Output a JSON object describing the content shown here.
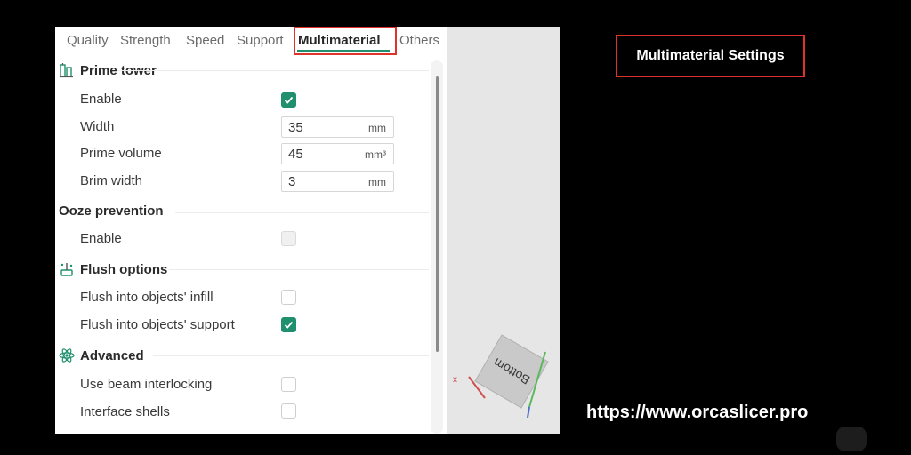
{
  "tabs": [
    {
      "label": "Quality"
    },
    {
      "label": "Strength"
    },
    {
      "label": "Speed"
    },
    {
      "label": "Support"
    },
    {
      "label": "Multimaterial",
      "active": true
    },
    {
      "label": "Others"
    }
  ],
  "sections": {
    "prime_tower": {
      "title": "Prime tower",
      "icon": "prime-tower-icon",
      "enable": {
        "label": "Enable",
        "checked": true
      },
      "width": {
        "label": "Width",
        "value": "35",
        "unit": "mm"
      },
      "prime_volume": {
        "label": "Prime volume",
        "value": "45",
        "unit": "mm³"
      },
      "brim_width": {
        "label": "Brim width",
        "value": "3",
        "unit": "mm"
      }
    },
    "ooze_prevention": {
      "title": "Ooze prevention",
      "enable": {
        "label": "Enable",
        "checked": false,
        "disabled": true
      }
    },
    "flush_options": {
      "title": "Flush options",
      "icon": "flush-icon",
      "infill": {
        "label": "Flush into objects' infill",
        "checked": false
      },
      "support": {
        "label": "Flush into objects' support",
        "checked": true
      }
    },
    "advanced": {
      "title": "Advanced",
      "icon": "atom-icon",
      "beam_interlocking": {
        "label": "Use beam interlocking",
        "checked": false
      },
      "interface_shells": {
        "label": "Interface shells",
        "checked": false
      }
    }
  },
  "viewport": {
    "cube_face_label": "Bottom",
    "axis_label": "x"
  },
  "caption": "Multimaterial Settings",
  "url": "https://www.orcaslicer.pro",
  "colors": {
    "accent": "#1f8f6d",
    "highlight": "#e0322c"
  }
}
